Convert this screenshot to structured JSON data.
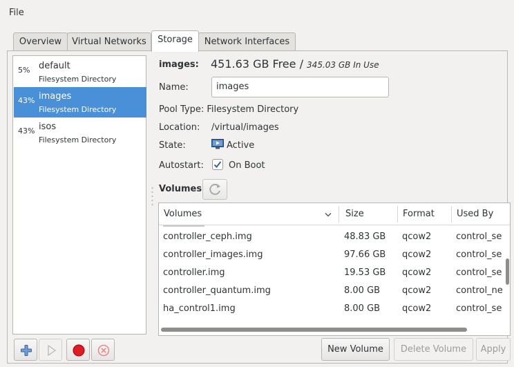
{
  "menu": {
    "file": "File"
  },
  "tabs": [
    {
      "label": "Overview"
    },
    {
      "label": "Virtual Networks"
    },
    {
      "label": "Storage"
    },
    {
      "label": "Network Interfaces"
    }
  ],
  "pools": [
    {
      "pct": "5%",
      "name": "default",
      "type": "Filesystem Directory"
    },
    {
      "pct": "43%",
      "name": "images",
      "type": "Filesystem Directory"
    },
    {
      "pct": "43%",
      "name": "isos",
      "type": "Filesystem Directory"
    }
  ],
  "detail": {
    "title": "images:",
    "free": "451.63 GB Free",
    "sep": " / ",
    "in_use": "345.03 GB In Use",
    "name_label": "Name:",
    "name_value": "images",
    "pool_type": "Pool Type: Filesystem Directory",
    "location_label": "Location:",
    "location_value": "/virtual/images",
    "state_label": "State:",
    "state_value": "Active",
    "autostart_label": "Autostart:",
    "autostart_value": "On Boot",
    "volumes_label": "Volumes"
  },
  "volumes": {
    "columns": [
      "Volumes",
      "Size",
      "Format",
      "Used By"
    ],
    "rows": [
      {
        "name": "controller_ceph.img",
        "size": "48.83 GB",
        "format": "qcow2",
        "used_by": "control_se"
      },
      {
        "name": "controller_images.img",
        "size": "97.66 GB",
        "format": "qcow2",
        "used_by": "control_se"
      },
      {
        "name": "controller.img",
        "size": "19.53 GB",
        "format": "qcow2",
        "used_by": "control_se"
      },
      {
        "name": "controller_quantum.img",
        "size": "8.00 GB",
        "format": "qcow2",
        "used_by": "control_ne"
      },
      {
        "name": "ha_control1.img",
        "size": "8.00 GB",
        "format": "qcow2",
        "used_by": "control_se"
      }
    ]
  },
  "buttons": {
    "new_volume": "New Volume",
    "delete_volume": "Delete Volume",
    "apply": "Apply"
  },
  "colors": {
    "selection": "#4a90d9",
    "stop_red": "#e01b24",
    "add_blue": "#3465a4"
  }
}
